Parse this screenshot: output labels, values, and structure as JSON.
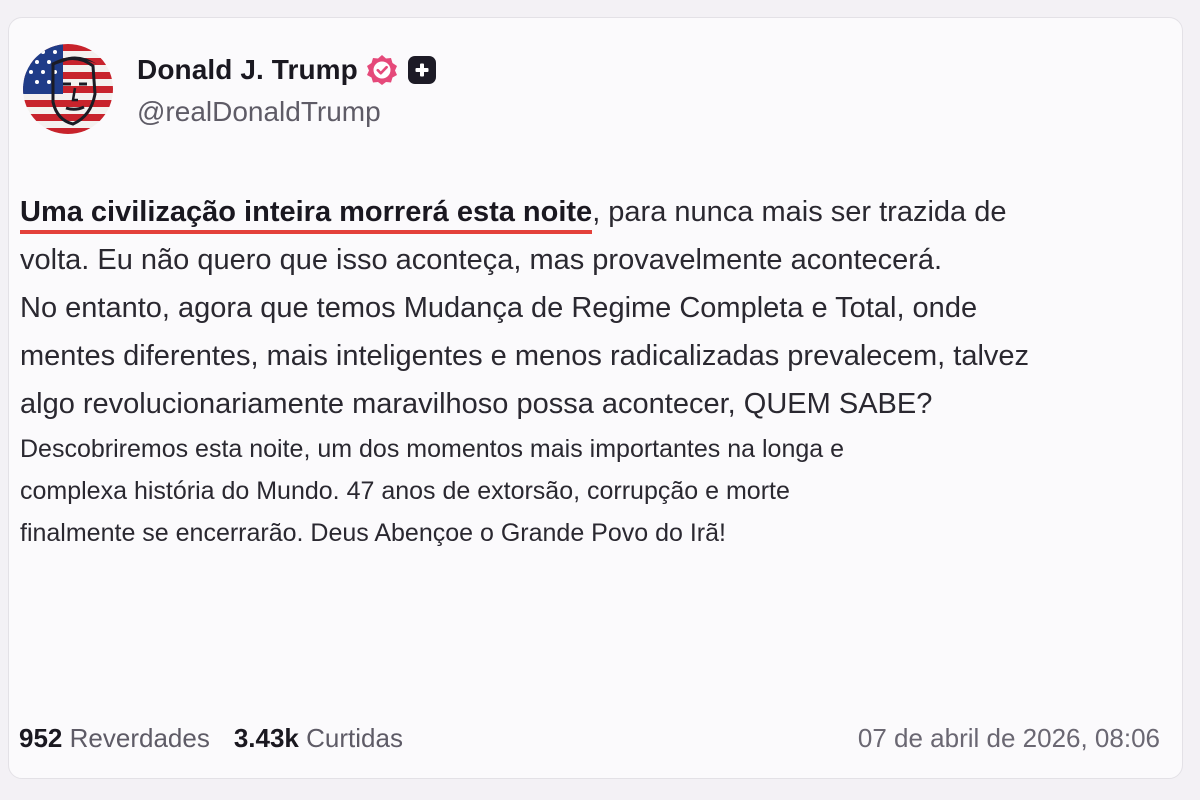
{
  "profile": {
    "display_name": "Donald J. Trump",
    "handle": "@realDonaldTrump",
    "avatar_icon": "flag-portrait-avatar",
    "verified_icon": "verified-badge-icon",
    "verified_color": "#e5497a",
    "plus_icon": "plus-box-icon"
  },
  "post": {
    "highlight": "Uma civilização inteira morrerá esta noite",
    "line1_rest": ", para nunca mais ser trazida de",
    "line2": "volta. Eu não quero que isso aconteça, mas provavelmente acontecerá.",
    "line3": "No entanto, agora que temos Mudança de Regime Completa e Total, onde",
    "line4": "mentes diferentes, mais inteligentes e menos radicalizadas prevalecem, talvez",
    "line5": "algo revolucionariamente maravilhoso possa acontecer, QUEM SABE?",
    "line6": "Descobriremos esta noite, um dos momentos mais importantes na longa e",
    "line7": "complexa história do Mundo. 47 anos de extorsão, corrupção e morte",
    "line8": "finalmente se encerrarão. Deus Abençoe o Grande Povo do Irã!",
    "highlight_underline_color": "#e4413b"
  },
  "stats": {
    "reposts_count": "952",
    "reposts_label": "Reverdades",
    "likes_count": "3.43k",
    "likes_label": "Curtidas",
    "timestamp": "07 de abril de 2026, 08:06"
  }
}
